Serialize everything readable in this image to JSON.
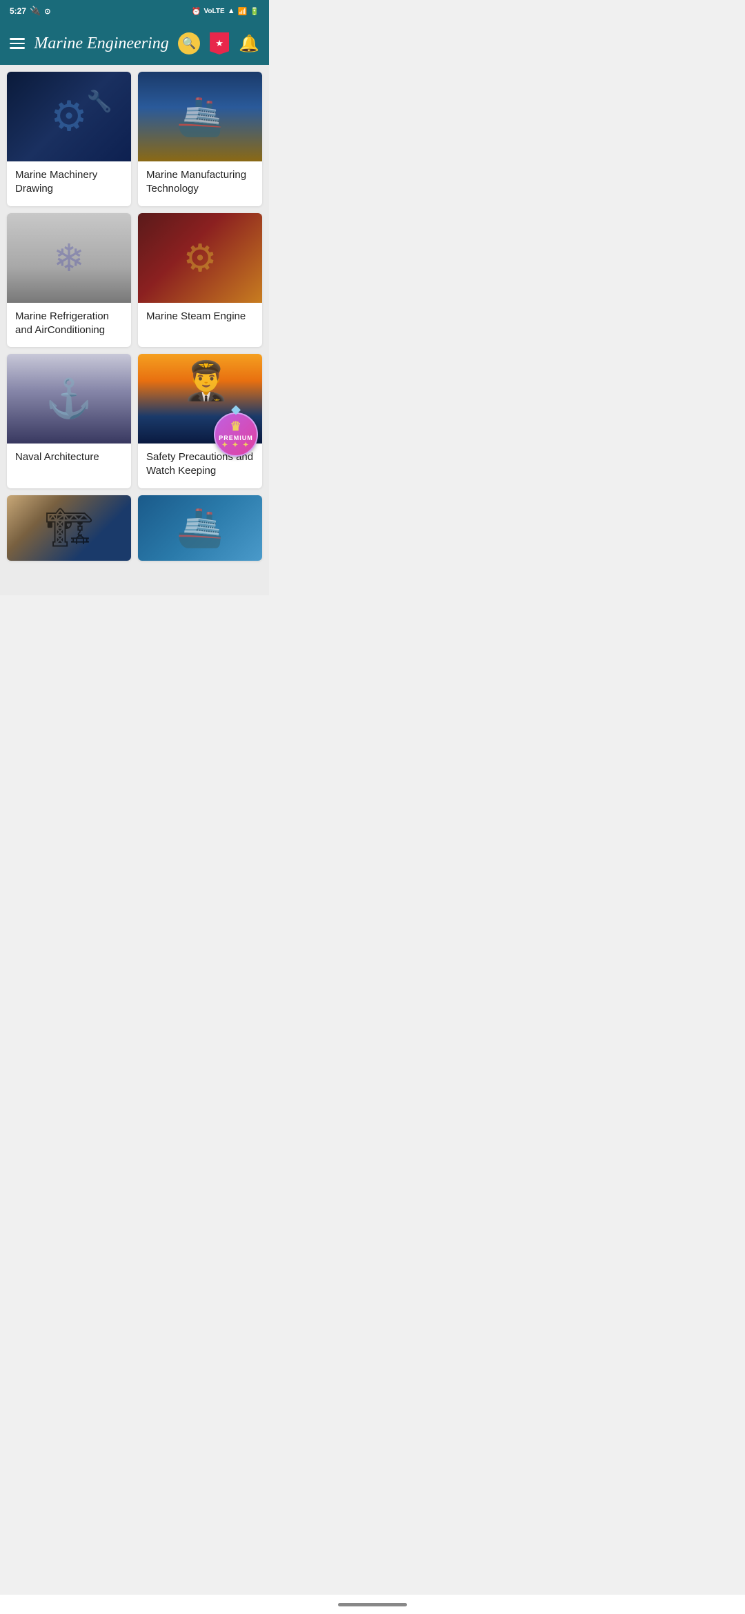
{
  "statusBar": {
    "time": "5:27",
    "icons": [
      "usb",
      "circle-icon",
      "alarm",
      "volte",
      "wifi",
      "signal1",
      "signal2",
      "battery"
    ]
  },
  "appBar": {
    "title": "Marine Engineering",
    "menuLabel": "menu",
    "searchLabel": "search",
    "bookmarkLabel": "bookmark",
    "notificationLabel": "notification"
  },
  "cards": [
    {
      "id": "marine-machinery-drawing",
      "title": "Marine Machinery Drawing",
      "imageType": "machinery",
      "premium": false
    },
    {
      "id": "marine-manufacturing-technology",
      "title": "Marine Manufacturing Technology",
      "imageType": "ship-build",
      "premium": false
    },
    {
      "id": "marine-refrigeration",
      "title": "Marine Refrigeration and AirConditioning",
      "imageType": "refrigeration",
      "premium": false
    },
    {
      "id": "marine-steam-engine",
      "title": "Marine Steam Engine",
      "imageType": "steam-engine",
      "premium": false
    },
    {
      "id": "naval-architecture",
      "title": "Naval Architecture",
      "imageType": "naval",
      "premium": false
    },
    {
      "id": "safety-precautions",
      "title": "Safety Precautions and Watch Keeping",
      "imageType": "safety",
      "premium": true,
      "premiumLabel": "PREMIUM"
    }
  ],
  "partialCards": [
    {
      "id": "partial-1",
      "imageType": "partial1"
    },
    {
      "id": "partial-2",
      "imageType": "partial2"
    }
  ],
  "bottomBar": {
    "pillLabel": "home-indicator"
  }
}
